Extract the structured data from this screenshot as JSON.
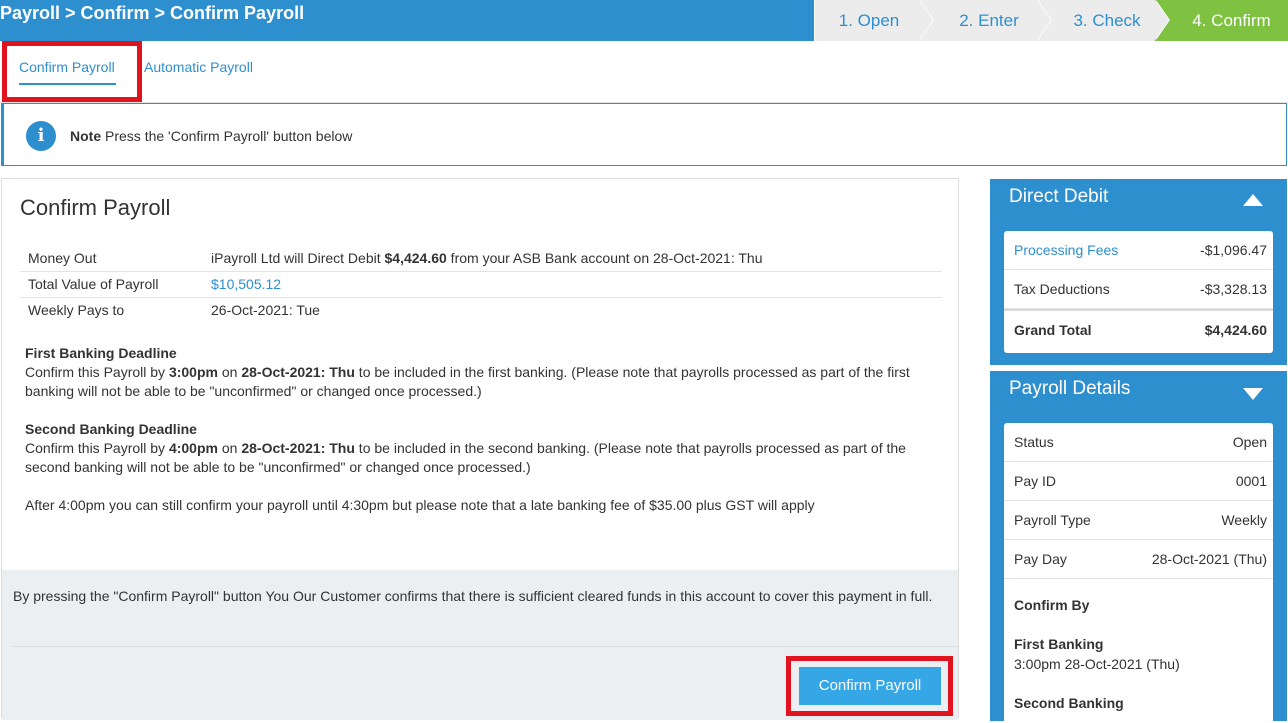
{
  "header": {
    "breadcrumb": "Payroll > Confirm > Confirm Payroll",
    "steps": [
      "1. Open",
      "2. Enter",
      "3. Check",
      "4. Confirm"
    ]
  },
  "tabs": {
    "confirm_payroll": "Confirm Payroll",
    "automatic_payroll": "Automatic Payroll"
  },
  "note": {
    "label": "Note",
    "text": "Press the 'Confirm Payroll' button below"
  },
  "main": {
    "title": "Confirm Payroll",
    "money_out_label": "Money Out",
    "money_out_pre": "iPayroll Ltd will Direct Debit ",
    "money_out_amount": "$4,424.60",
    "money_out_post": " from your ASB Bank account on 28-Oct-2021: Thu",
    "total_value_label": "Total Value of Payroll",
    "total_value": "$10,505.12",
    "weekly_pays_label": "Weekly Pays to",
    "weekly_pays": "26-Oct-2021: Tue",
    "first_deadline_title": "First Banking Deadline",
    "first_pre": "Confirm this Payroll by ",
    "first_time": "3:00pm",
    "first_on": " on ",
    "first_date": "28-Oct-2021: Thu",
    "first_post": " to be included in the first banking. (Please note that payrolls processed as part of the first banking will not be able to be \"unconfirmed\" or changed once processed.)",
    "second_deadline_title": "Second Banking Deadline",
    "second_pre": "Confirm this Payroll by ",
    "second_time": "4:00pm",
    "second_on": " on ",
    "second_date": "28-Oct-2021: Thu",
    "second_post": " to be included in the second banking. (Please note that payrolls processed as part of the second banking will not be able to be \"unconfirmed\" or changed once processed.)",
    "late_note": "After 4:00pm you can still confirm your payroll until 4:30pm but please note that a late banking fee of $35.00 plus GST will apply",
    "footer_text": "By pressing the \"Confirm Payroll\" button You Our Customer confirms that there is sufficient cleared funds in this account to cover this payment in full.",
    "confirm_button": "Confirm Payroll"
  },
  "direct_debit": {
    "title": "Direct Debit",
    "processing_fees_label": "Processing Fees",
    "processing_fees": "-$1,096.47",
    "tax_deductions_label": "Tax Deductions",
    "tax_deductions": "-$3,328.13",
    "grand_total_label": "Grand Total",
    "grand_total": "$4,424.60"
  },
  "payroll_details": {
    "title": "Payroll Details",
    "status_label": "Status",
    "status": "Open",
    "pay_id_label": "Pay ID",
    "pay_id": "0001",
    "payroll_type_label": "Payroll Type",
    "payroll_type": "Weekly",
    "pay_day_label": "Pay Day",
    "pay_day": "28-Oct-2021 (Thu)",
    "confirm_by_label": "Confirm By",
    "first_banking_label": "First Banking",
    "first_banking": "3:00pm 28-Oct-2021 (Thu)",
    "second_banking_label": "Second Banking"
  },
  "colors": {
    "brand_blue": "#2e8fcf",
    "active_step_green": "#7fc241",
    "button_blue": "#35a6e6",
    "highlight_red": "#e0141e"
  }
}
